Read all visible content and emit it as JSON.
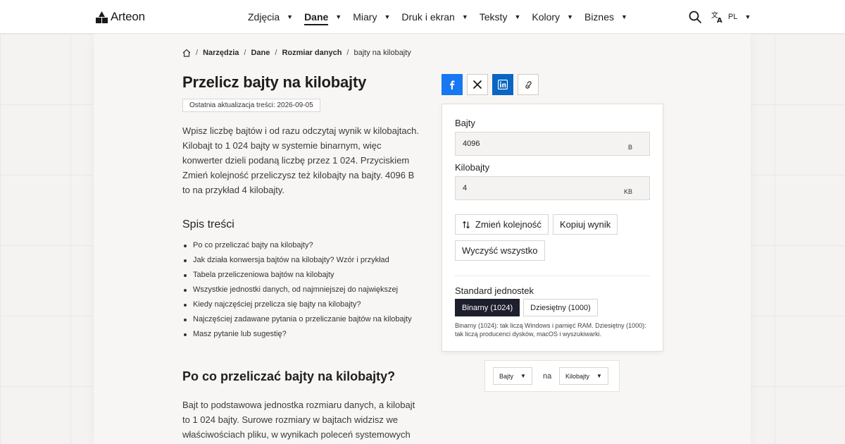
{
  "header": {
    "logo_text": "Arteon",
    "nav": [
      {
        "label": "Zdjęcia",
        "active": false
      },
      {
        "label": "Dane",
        "active": true
      },
      {
        "label": "Miary",
        "active": false
      },
      {
        "label": "Druk i ekran",
        "active": false
      },
      {
        "label": "Teksty",
        "active": false
      },
      {
        "label": "Kolory",
        "active": false
      },
      {
        "label": "Biznes",
        "active": false
      }
    ],
    "lang_code": "PL"
  },
  "breadcrumb": {
    "items": [
      "Narzędzia",
      "Dane",
      "Rozmiar danych"
    ],
    "current": "bajty na kilobajty"
  },
  "article": {
    "title": "Przelicz bajty na kilobajty",
    "updated": "Ostatnia aktualizacja treści: 2026-09-05",
    "intro": "Wpisz liczbę bajtów i od razu odczytaj wynik w kilobajtach. Kilobajt to 1 024 bajty w systemie binarnym, więc konwerter dzieli podaną liczbę przez 1 024. Przyciskiem Zmień kolejność przeliczysz też kilobajty na bajty. 4096 B to na przykład 4 kilobajty.",
    "toc_title": "Spis treści",
    "toc": [
      "Po co przeliczać bajty na kilobajty?",
      "Jak działa konwersja bajtów na kilobajty? Wzór i przykład",
      "Tabela przeliczeniowa bajtów na kilobajty",
      "Wszystkie jednostki danych, od najmniejszej do największej",
      "Kiedy najczęściej przelicza się bajty na kilobajty?",
      "Najczęściej zadawane pytania o przeliczanie bajtów na kilobajty",
      "Masz pytanie lub sugestię?"
    ],
    "section_title": "Po co przeliczać bajty na kilobajty?",
    "section_text": "Bajt to podstawowa jednostka rozmiaru danych, a kilobajt to 1 024 bajty. Surowe rozmiary w bajtach widzisz we właściwościach pliku, w wynikach poleceń systemowych"
  },
  "converter": {
    "from_label": "Bajty",
    "from_value": "4096",
    "from_unit": "B",
    "to_label": "Kilobajty",
    "to_value": "4",
    "to_unit": "KB",
    "swap_label": "Zmień kolejność",
    "copy_label": "Kopiuj wynik",
    "clear_label": "Wyczyść wszystko",
    "standard_label": "Standard jednostek",
    "binary_label": "Binarny (1024)",
    "decimal_label": "Dziesiętny (1000)",
    "standard_note": "Binarny (1024): tak liczą Windows i pamięć RAM. Dziesiętny (1000): tak liczą producenci dysków, macOS i wyszukiwarki."
  },
  "picker": {
    "from": "Bajty",
    "connector": "na",
    "to": "Kilobajty"
  },
  "colors": {
    "facebook": "#1877f2",
    "linkedin": "#0a66c2",
    "active_segment": "#1d1f2c"
  }
}
